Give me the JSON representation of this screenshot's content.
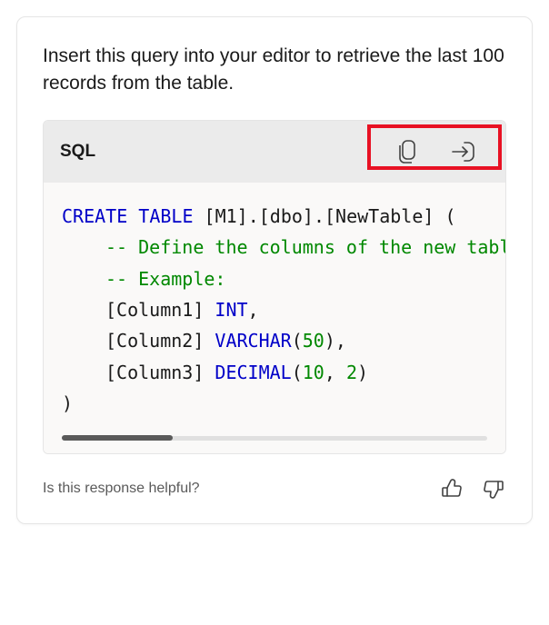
{
  "intro": "Insert this query into your editor to retrieve the last 100 records from the table.",
  "code": {
    "label": "SQL",
    "keyword_create": "CREATE TABLE",
    "table_ref": "[M1].[dbo].[NewTable]",
    "open_paren": " (",
    "comment1": "-- Define the columns of the new tabl",
    "comment2": "-- Example:",
    "col1_name": "[Column1] ",
    "col1_type": "INT",
    "comma": ",",
    "col2_name": "[Column2] ",
    "col2_type": "VARCHAR",
    "col2_open": "(",
    "col2_arg": "50",
    "col2_close": ")",
    "col3_name": "[Column3] ",
    "col3_type": "DECIMAL",
    "col3_open": "(",
    "col3_arg1": "10",
    "col3_sep": ", ",
    "col3_arg2": "2",
    "col3_close": ")",
    "close_paren": ")"
  },
  "feedback": {
    "prompt": "Is this response helpful?"
  }
}
